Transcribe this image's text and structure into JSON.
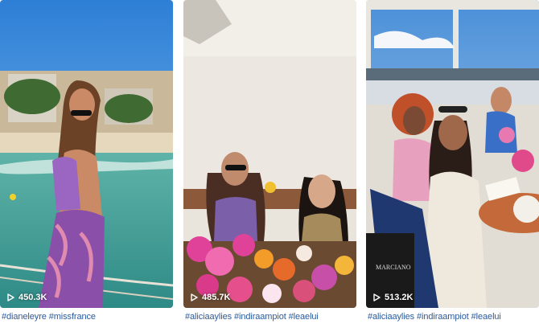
{
  "videos": [
    {
      "views": "450.3K",
      "caption": "#dianeleyre #missfrance"
    },
    {
      "views": "485.7K",
      "caption": "#aliciaaylies #indiraampiot #leaelui"
    },
    {
      "views": "513.2K",
      "caption": "#aliciaaylies #indiraampiot #leaelui"
    }
  ],
  "icons": {
    "views": "play-icon"
  },
  "colors": {
    "caption": "#2b5a9c",
    "view_count": "#ffffff"
  }
}
